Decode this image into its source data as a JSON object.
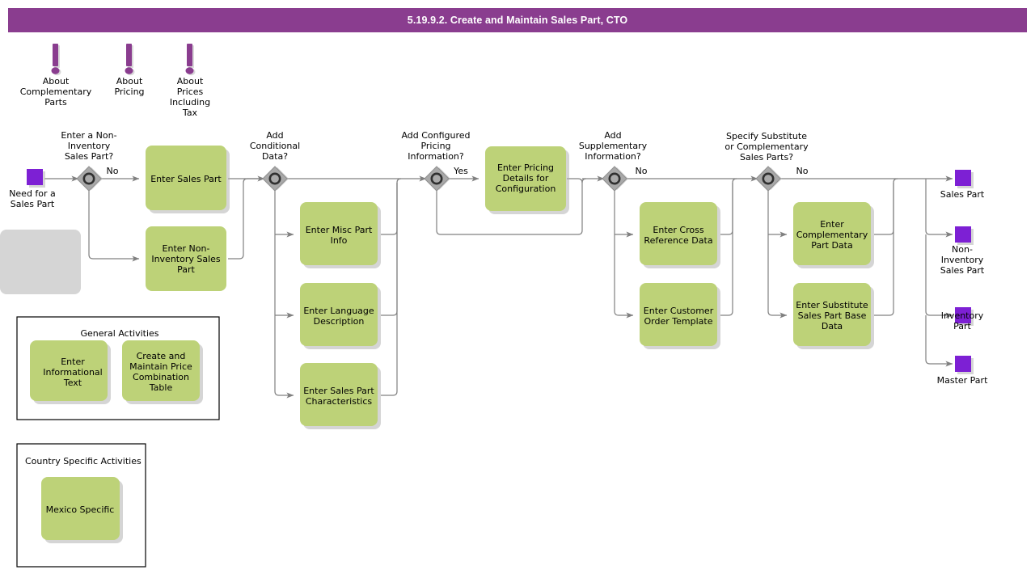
{
  "window": {
    "title": "5.19.9.2. Create and Maintain Sales Part, CTO"
  },
  "colors": {
    "title_bar": "#8a3d8f",
    "task_fill": "#bdd278",
    "event_fill": "#7d20d4",
    "gateway_fill": "#a9a9a9",
    "connector": "#808080",
    "group_border": "#000000",
    "canvas": "#ffffff"
  },
  "info_notes": [
    {
      "id": "note-complementary-parts",
      "icon": "information-icon",
      "lines": [
        "About",
        "Complementary",
        "Parts"
      ]
    },
    {
      "id": "note-pricing",
      "icon": "information-icon",
      "lines": [
        "About",
        "Pricing"
      ]
    },
    {
      "id": "note-prices-including-tax",
      "icon": "information-icon",
      "lines": [
        "About",
        "Prices",
        "Including",
        "Tax"
      ]
    }
  ],
  "start_events": [
    {
      "id": "start-need-for-sales-part",
      "lines": [
        "Need for a",
        "Sales Part"
      ]
    }
  ],
  "end_events": [
    {
      "id": "end-sales-part",
      "lines": [
        "Sales Part"
      ]
    },
    {
      "id": "end-non-inventory-sales-part",
      "lines": [
        "Non-",
        "Inventory",
        "Sales Part"
      ]
    },
    {
      "id": "end-inventory-part",
      "lines": [
        "Inventory",
        "Part"
      ]
    },
    {
      "id": "end-master-part",
      "lines": [
        "Master Part"
      ]
    }
  ],
  "gateways": [
    {
      "id": "gw-non-inventory-sales-part",
      "lines": [
        "Enter a Non-",
        "Inventory",
        "Sales Part?"
      ],
      "branch_label": "No"
    },
    {
      "id": "gw-conditional-data",
      "lines": [
        "Add",
        "Conditional",
        "Data?"
      ],
      "branch_label": ""
    },
    {
      "id": "gw-configured-pricing",
      "lines": [
        "Add Configured",
        "Pricing",
        "Information?"
      ],
      "branch_label": "Yes"
    },
    {
      "id": "gw-supplementary-information",
      "lines": [
        "Add",
        "Supplementary",
        "Information?"
      ],
      "branch_label": "No"
    },
    {
      "id": "gw-substitute-complementary",
      "lines": [
        "Specify Substitute",
        "or Complementary",
        "Sales Parts?"
      ],
      "branch_label": "No"
    }
  ],
  "tasks": [
    {
      "id": "task-enter-sales-part",
      "lines": [
        "Enter Sales Part"
      ]
    },
    {
      "id": "task-enter-non-inventory-sales-part",
      "lines": [
        "Enter Non-",
        "Inventory Sales",
        "Part"
      ]
    },
    {
      "id": "task-enter-misc-part-info",
      "lines": [
        "Enter Misc Part",
        "Info"
      ]
    },
    {
      "id": "task-enter-language-description",
      "lines": [
        "Enter Language",
        "Description"
      ]
    },
    {
      "id": "task-enter-sales-part-characteristics",
      "lines": [
        "Enter Sales Part",
        "Characteristics"
      ]
    },
    {
      "id": "task-enter-pricing-details-for-configuration",
      "lines": [
        "Enter Pricing",
        "Details for",
        "Configuration"
      ]
    },
    {
      "id": "task-enter-cross-reference-data",
      "lines": [
        "Enter Cross",
        "Reference Data"
      ]
    },
    {
      "id": "task-enter-customer-order-template",
      "lines": [
        "Enter Customer",
        "Order Template"
      ]
    },
    {
      "id": "task-enter-complementary-part-data",
      "lines": [
        "Enter",
        "Complementary",
        "Part Data"
      ]
    },
    {
      "id": "task-enter-substitute-sales-part-base-data",
      "lines": [
        "Enter Substitute",
        "Sales Part Base",
        "Data"
      ]
    }
  ],
  "groups": [
    {
      "id": "group-general-activities",
      "title": "General Activities",
      "tasks": [
        {
          "id": "task-enter-informational-text",
          "lines": [
            "Enter",
            "Informational",
            "Text"
          ]
        },
        {
          "id": "task-create-and-maintain-price-combination-table",
          "lines": [
            "Create and",
            "Maintain Price",
            "Combination",
            "Table"
          ]
        }
      ]
    },
    {
      "id": "group-country-specific-activities",
      "title": "Country Specific Activities",
      "tasks": [
        {
          "id": "task-mexico-specific",
          "lines": [
            "Mexico Specific"
          ]
        }
      ]
    }
  ]
}
